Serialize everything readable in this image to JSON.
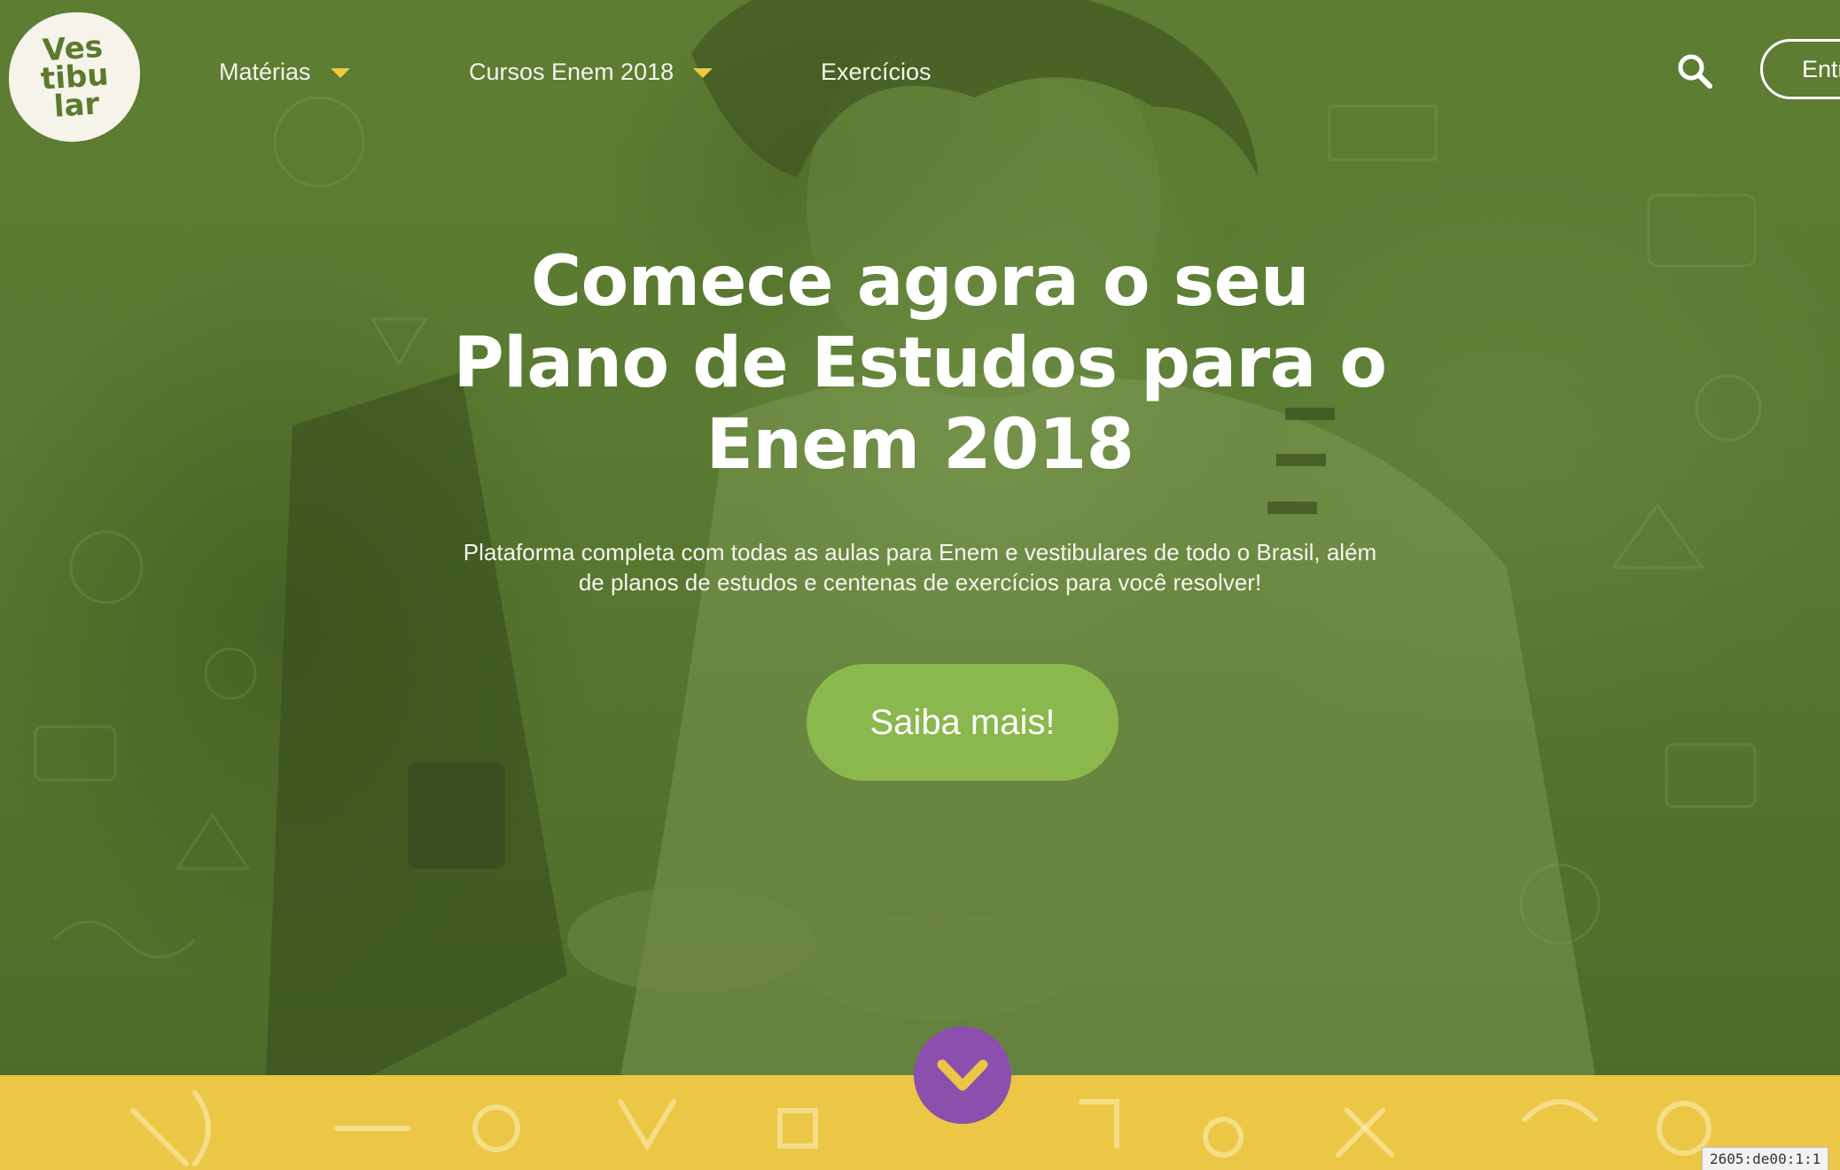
{
  "logo": {
    "line1": "Ves",
    "line2": "tibu",
    "line3": "lar"
  },
  "nav": {
    "items": [
      {
        "label": "Matérias",
        "has_dropdown": true
      },
      {
        "label": "Cursos Enem 2018",
        "has_dropdown": true
      },
      {
        "label": "Exercícios",
        "has_dropdown": false
      }
    ],
    "search_icon": "search-icon",
    "login_label": "Entr"
  },
  "hero": {
    "headline": "Comece agora o seu Plano de Estudos para o Enem 2018",
    "subtext": "Plataforma completa com todas as aulas para Enem e vestibulares de todo o Brasil, além de planos de estudos e centenas de exercícios para você resolver!",
    "cta_label": "Saiba mais!"
  },
  "scroll_down_icon": "chevron-down-icon",
  "status_tip": "2605:de00:1:1",
  "colors": {
    "hero_green": "#5a7a33",
    "cta_green": "#8ab84d",
    "caret_yellow": "#f0c93e",
    "band_yellow": "#ecc645",
    "scroll_purple": "#8b4fae",
    "logo_green": "#5a7a2e"
  }
}
